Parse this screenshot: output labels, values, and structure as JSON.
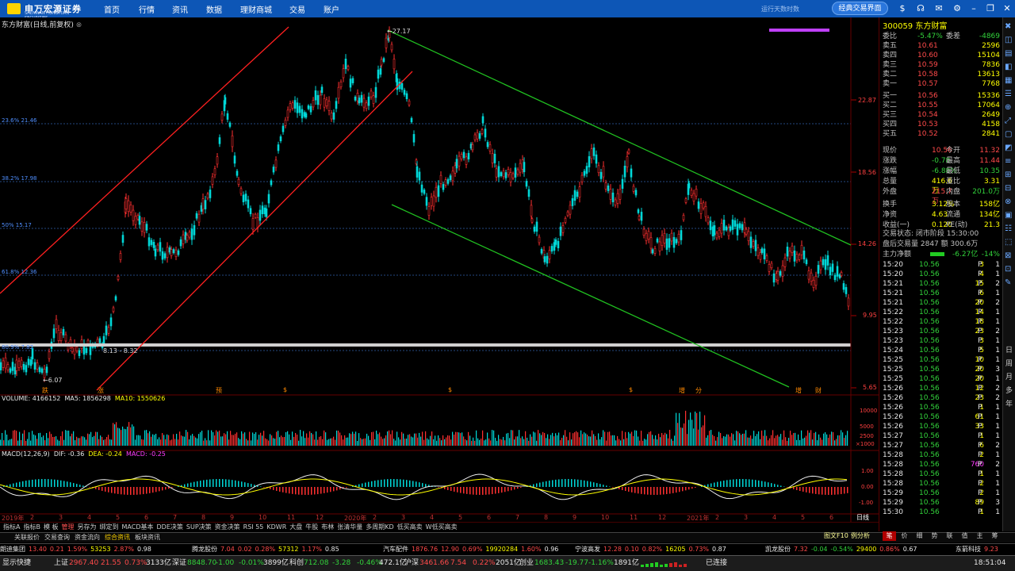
{
  "app": {
    "logo_text": "申万宏源证券",
    "logo_sub": "SHENWAN HONGYUAN SECURITIES",
    "nav": [
      "首页",
      "行情",
      "资讯",
      "数据",
      "理财商城",
      "交易",
      "账户"
    ],
    "running_days": "运行天数时数",
    "classic_button": "经典交易界面",
    "time": "18:51:04"
  },
  "chart": {
    "title": "东方财富(日线,前复权)",
    "peak_label": "27.17",
    "low_label": "6.07",
    "band_label": "8.13 - 8.32",
    "fib": [
      "23.6% 21.46",
      "38.2% 17.98",
      "50% 15.17",
      "61.8% 12.36",
      "80.9% 7.82"
    ],
    "yaxis": [
      "22.87",
      "18.56",
      "14.26",
      "9.95",
      "5.65"
    ],
    "vol_title": "VOLUME: 4166152",
    "ma5": "MA5: 1856298",
    "ma10": "MA10: 1550626",
    "vol_axis": [
      "10000",
      "5000",
      "2500",
      "×1000"
    ],
    "macd_title": "MACD(12,26,9)",
    "dif": "DIF: -0.36",
    "dea": "DEA: -0.24",
    "macd": "MACD: -0.25",
    "macd_axis": [
      "1.00",
      "0.00",
      "-1.00"
    ],
    "months": [
      "2019年",
      "2",
      "3",
      "4",
      "5",
      "6",
      "7",
      "8",
      "9",
      "10",
      "11",
      "12",
      "2020年",
      "2",
      "3",
      "4",
      "5",
      "6",
      "7",
      "8",
      "9",
      "10",
      "11",
      "12",
      "2021年",
      "2",
      "3",
      "4",
      "5",
      "6"
    ],
    "period": "日线",
    "event_marks": [
      "跌",
      "涨",
      "预",
      "$",
      "$",
      "$",
      "增",
      "分",
      "增",
      "财"
    ]
  },
  "quote": {
    "code": "300059",
    "name": "东方财富",
    "weibi": {
      "label": "委比",
      "value": "-5.47%",
      "diff_label": "委差",
      "diff": "-4869"
    },
    "sells": [
      {
        "l": "卖五",
        "p": "10.61",
        "v": "2596"
      },
      {
        "l": "卖四",
        "p": "10.60",
        "v": "15104"
      },
      {
        "l": "卖三",
        "p": "10.59",
        "v": "7836"
      },
      {
        "l": "卖二",
        "p": "10.58",
        "v": "13613"
      },
      {
        "l": "卖一",
        "p": "10.57",
        "v": "7768"
      }
    ],
    "buys": [
      {
        "l": "买一",
        "p": "10.56",
        "v": "15336"
      },
      {
        "l": "买二",
        "p": "10.55",
        "v": "17064"
      },
      {
        "l": "买三",
        "p": "10.54",
        "v": "2649"
      },
      {
        "l": "买四",
        "p": "10.53",
        "v": "4158"
      },
      {
        "l": "买五",
        "p": "10.52",
        "v": "2841"
      }
    ],
    "stats": [
      [
        "现价",
        "10.56",
        "今开",
        "11.32"
      ],
      [
        "涨跌",
        "-0.78",
        "最高",
        "11.44"
      ],
      [
        "涨幅",
        "-6.88%",
        "最低",
        "10.35"
      ],
      [
        "总量",
        "416.6万",
        "量比",
        "3.31"
      ],
      [
        "外盘",
        "215.7万",
        "内盘",
        "201.0万"
      ],
      [
        "换手",
        "3.12%",
        "股本",
        "158亿"
      ],
      [
        "净资",
        "4.63",
        "流通",
        "134亿"
      ],
      [
        "收益(一)",
        "0.120",
        "PE(动)",
        "21.3"
      ]
    ],
    "trade_status": "交易状态: 闭市阶段 15:30:00",
    "after_trade": "盘后交易量 2847 额 300.6万",
    "main_flow": "主力净额",
    "main_flow_val": "-6.27亿",
    "main_flow_pct": "-14%",
    "ticks": [
      [
        "15:20",
        "10.56",
        "3",
        "P",
        "1"
      ],
      [
        "15:20",
        "10.56",
        "4",
        "P",
        "1"
      ],
      [
        "15:21",
        "10.56",
        "15",
        "P",
        "2"
      ],
      [
        "15:21",
        "10.56",
        "6",
        "P",
        "1"
      ],
      [
        "15:21",
        "10.56",
        "20",
        "P",
        "2"
      ],
      [
        "15:22",
        "10.56",
        "14",
        "P",
        "1"
      ],
      [
        "15:22",
        "10.56",
        "18",
        "P",
        "1"
      ],
      [
        "15:23",
        "10.56",
        "23",
        "P",
        "2"
      ],
      [
        "15:23",
        "10.56",
        "3",
        "P",
        "1"
      ],
      [
        "15:24",
        "10.56",
        "5",
        "P",
        "1"
      ],
      [
        "15:25",
        "10.56",
        "10",
        "P",
        "1"
      ],
      [
        "15:25",
        "10.56",
        "20",
        "P",
        "3"
      ],
      [
        "15:25",
        "10.56",
        "20",
        "P",
        "1"
      ],
      [
        "15:26",
        "10.56",
        "12",
        "P",
        "2"
      ],
      [
        "15:26",
        "10.56",
        "23",
        "P",
        "2"
      ],
      [
        "15:26",
        "10.56",
        "1",
        "P",
        "1"
      ],
      [
        "15:26",
        "10.56",
        "61",
        "P",
        "1"
      ],
      [
        "15:26",
        "10.56",
        "33",
        "P",
        "1"
      ],
      [
        "15:27",
        "10.56",
        "1",
        "P",
        "1"
      ],
      [
        "15:27",
        "10.56",
        "6",
        "P",
        "2"
      ],
      [
        "15:28",
        "10.56",
        "2",
        "P",
        "1"
      ],
      [
        "15:28",
        "10.56",
        "760",
        "P",
        "2"
      ],
      [
        "15:28",
        "10.56",
        "1",
        "P",
        "1"
      ],
      [
        "15:28",
        "10.56",
        "2",
        "P",
        "1"
      ],
      [
        "15:29",
        "10.56",
        "2",
        "P",
        "1"
      ],
      [
        "15:29",
        "10.56",
        "89",
        "P",
        "3"
      ],
      [
        "15:30",
        "10.56",
        "1",
        "P",
        "1"
      ]
    ],
    "tabs": [
      "笔",
      "价",
      "细",
      "势",
      "联",
      "值",
      "主",
      "筹"
    ],
    "tabs2": [
      "图文F10",
      "例分析"
    ]
  },
  "indicator_tabs": [
    "指标A",
    "指标B",
    "模 板",
    "管理",
    "另存为",
    "绑定到",
    "MACD基本",
    "DDE决策",
    "SUP决策",
    "资金决策",
    "RSI 55",
    "KDWR",
    "大盘",
    "牛股",
    "布林",
    "张清华量",
    "多周期KD",
    "低买高卖",
    "W低买高卖"
  ],
  "tabs_row2": [
    "关联报价",
    "交易查询",
    "资金流向",
    "综合资讯",
    "板块资讯"
  ],
  "ticker": [
    {
      "n": "朗迪集团",
      "v": [
        "13.40",
        "0.21",
        "1.59%",
        "53253",
        "2.87%",
        "0.98"
      ]
    },
    {
      "n": "腾龙股份",
      "v": [
        "7.04",
        "0.02",
        "0.28%",
        "57312",
        "1.17%",
        "0.85"
      ]
    },
    {
      "n": "汽车配件",
      "v": [
        "1876.76",
        "12.90",
        "0.69%",
        "19920284",
        "1.60%",
        "0.96"
      ]
    },
    {
      "n": "宁波高发",
      "v": [
        "12.28",
        "0.10",
        "0.82%",
        "16205",
        "0.73%",
        "0.87"
      ]
    },
    {
      "n": "凯龙股份",
      "v": [
        "7.32",
        "-0.04",
        "-0.54%",
        "29400",
        "0.86%",
        "0.67"
      ]
    },
    {
      "n": "东箭科技",
      "v": [
        "9.23"
      ]
    }
  ],
  "status": {
    "shortcut": "显示快捷",
    "sh": "上证",
    "sh_v": "2967.40",
    "sh_c": "21.55",
    "sh_p": "0.73%",
    "sh_a": "3133亿",
    "sz": "深证",
    "sz_v": "8848.70",
    "sz_c": "-1.00",
    "sz_p": "-0.01%",
    "sz_a": "3899亿",
    "kc": "科创",
    "kc_v": "712.08",
    "kc_c": "-3.28",
    "kc_p": "-0.46%",
    "kc_a": "472.1亿",
    "hs": "沪深",
    "hs_v": "3461.66",
    "hs_c": "7.54",
    "hs_p": "0.22%",
    "hs_a": "2051亿",
    "cy": "创业",
    "cy_v": "1683.43",
    "cy_c": "-19.77",
    "cy_p": "-1.16%",
    "cy_a": "1891亿",
    "conn": "已连接"
  },
  "right_tool": [
    "日",
    "周",
    "月",
    "多",
    "年"
  ],
  "colors": {
    "up": "#ff3030",
    "down": "#00e0e0",
    "channel_up": "#ff2020",
    "channel_down": "#20c020",
    "fib_line": "#2a4f8f"
  }
}
